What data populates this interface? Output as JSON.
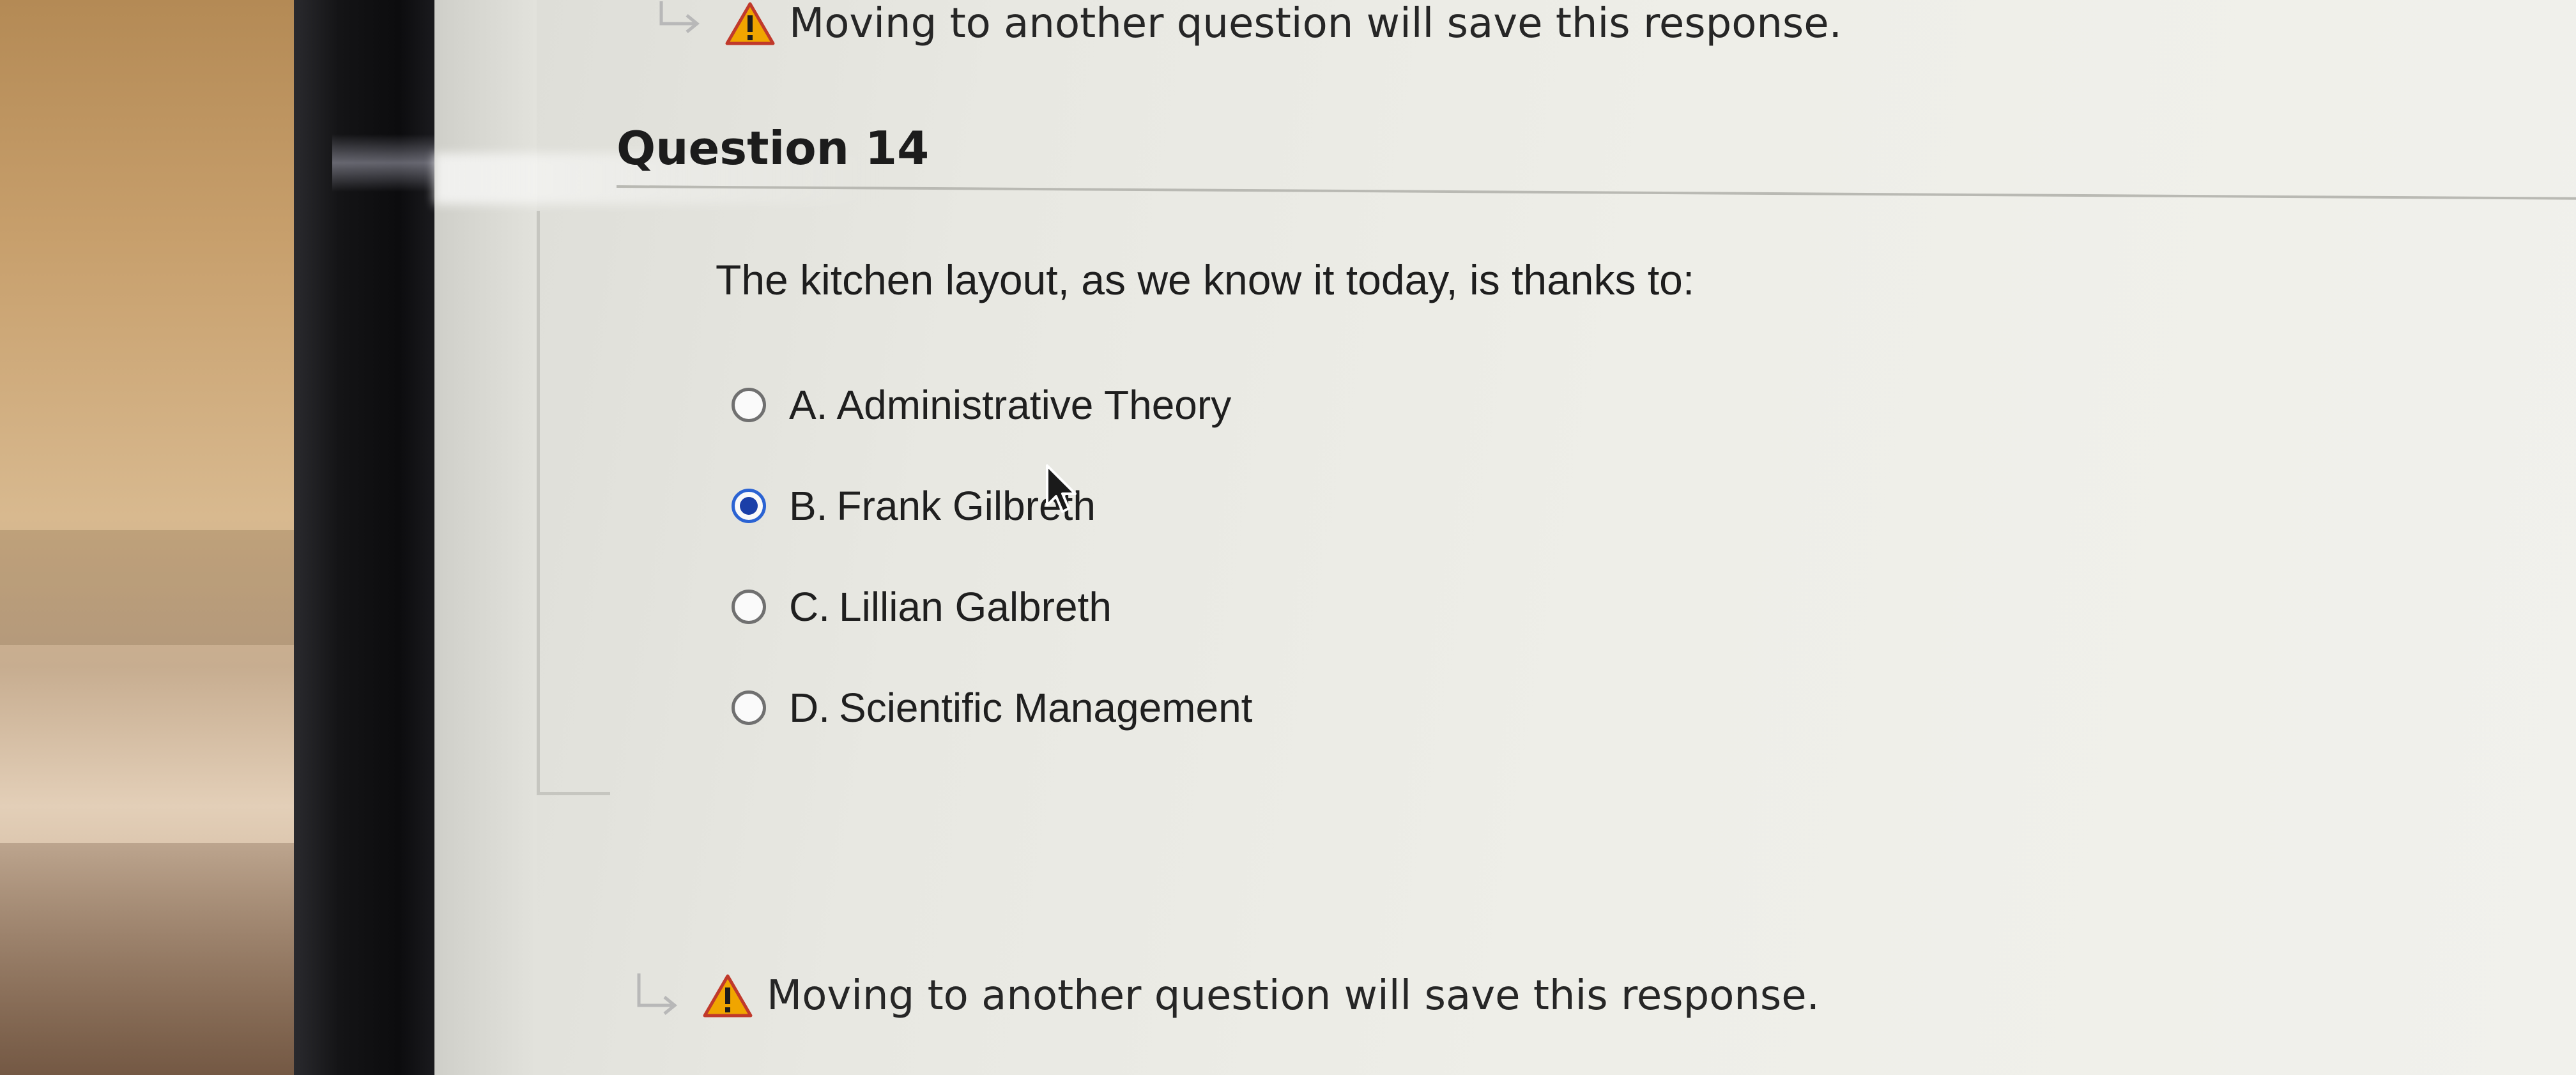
{
  "notice": {
    "save_warning_top": "Moving to another question will save this response.",
    "save_warning_bottom": "Moving to another question will save this response."
  },
  "question": {
    "title": "Question 14",
    "prompt": "The kitchen layout, as we know it today, is thanks to:",
    "options": [
      {
        "letter": "A.",
        "text": "Administrative Theory",
        "selected": false
      },
      {
        "letter": "B.",
        "text": "Frank Gilbreth",
        "selected": true
      },
      {
        "letter": "C.",
        "text": "Lillian Galbreth",
        "selected": false
      },
      {
        "letter": "D.",
        "text": "Scientific Management",
        "selected": false
      }
    ]
  },
  "icons": {
    "warning": "warning-triangle-icon",
    "arrow": "return-arrow-icon",
    "cursor": "mouse-pointer-icon"
  },
  "colors": {
    "radio_selected": "#1a3fa8",
    "warning_fill": "#f0a500",
    "warning_stroke": "#c0392b"
  }
}
